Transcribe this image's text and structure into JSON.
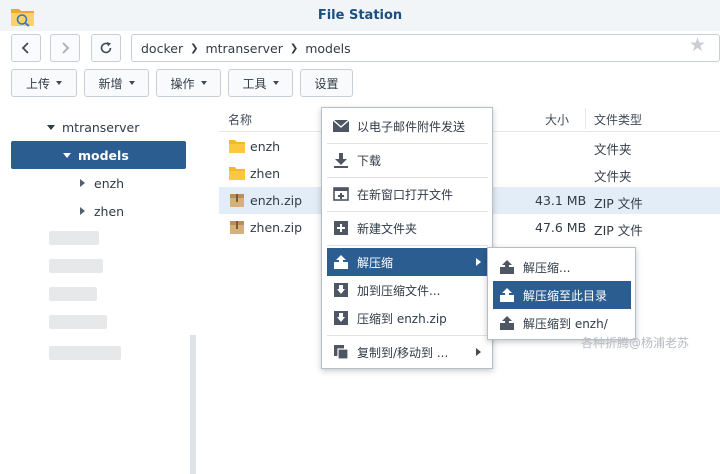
{
  "window": {
    "title": "File Station"
  },
  "nav": {
    "path": [
      "docker",
      "mtranserver",
      "models"
    ]
  },
  "toolbar": {
    "upload": "上传",
    "create": "新增",
    "action": "操作",
    "tools": "工具",
    "settings": "设置"
  },
  "sidebar": {
    "items": [
      {
        "label": "mtranserver"
      },
      {
        "label": "models"
      },
      {
        "label": "enzh"
      },
      {
        "label": "zhen"
      }
    ]
  },
  "files": {
    "headers": {
      "name": "名称",
      "size": "大小",
      "type": "文件类型"
    },
    "rows": [
      {
        "name": "enzh",
        "size": "",
        "type": "文件夹",
        "icon": "folder-icon"
      },
      {
        "name": "zhen",
        "size": "",
        "type": "文件夹",
        "icon": "folder-icon"
      },
      {
        "name": "enzh.zip",
        "size": "43.1 MB",
        "type": "ZIP 文件",
        "icon": "zip-file-icon"
      },
      {
        "name": "zhen.zip",
        "size": "47.6 MB",
        "type": "ZIP 文件",
        "icon": "zip-file-icon"
      }
    ]
  },
  "context_menu": {
    "items": [
      {
        "label": "以电子邮件附件发送",
        "icon": "mail-icon"
      },
      {
        "label": "下载",
        "icon": "download-icon"
      },
      {
        "label": "在新窗口打开文件",
        "icon": "new-window-icon"
      },
      {
        "label": "新建文件夹",
        "icon": "new-folder-icon"
      },
      {
        "label": "解压缩",
        "icon": "extract-icon"
      },
      {
        "label": "加到压缩文件...",
        "icon": "compress-icon"
      },
      {
        "label": "压缩到 enzh.zip",
        "icon": "compress-icon"
      },
      {
        "label": "复制到/移动到 ...",
        "icon": "copy-move-icon"
      }
    ]
  },
  "submenu": {
    "items": [
      {
        "label": "解压缩..."
      },
      {
        "label": "解压缩至此目录"
      },
      {
        "label": "解压缩到 enzh/"
      }
    ]
  },
  "watermark": "各种折腾@杨浦老苏",
  "colors": {
    "accent": "#2b5d91",
    "title": "#1b4f80",
    "selection": "#e3edf7",
    "folder": "#f5b82a"
  }
}
